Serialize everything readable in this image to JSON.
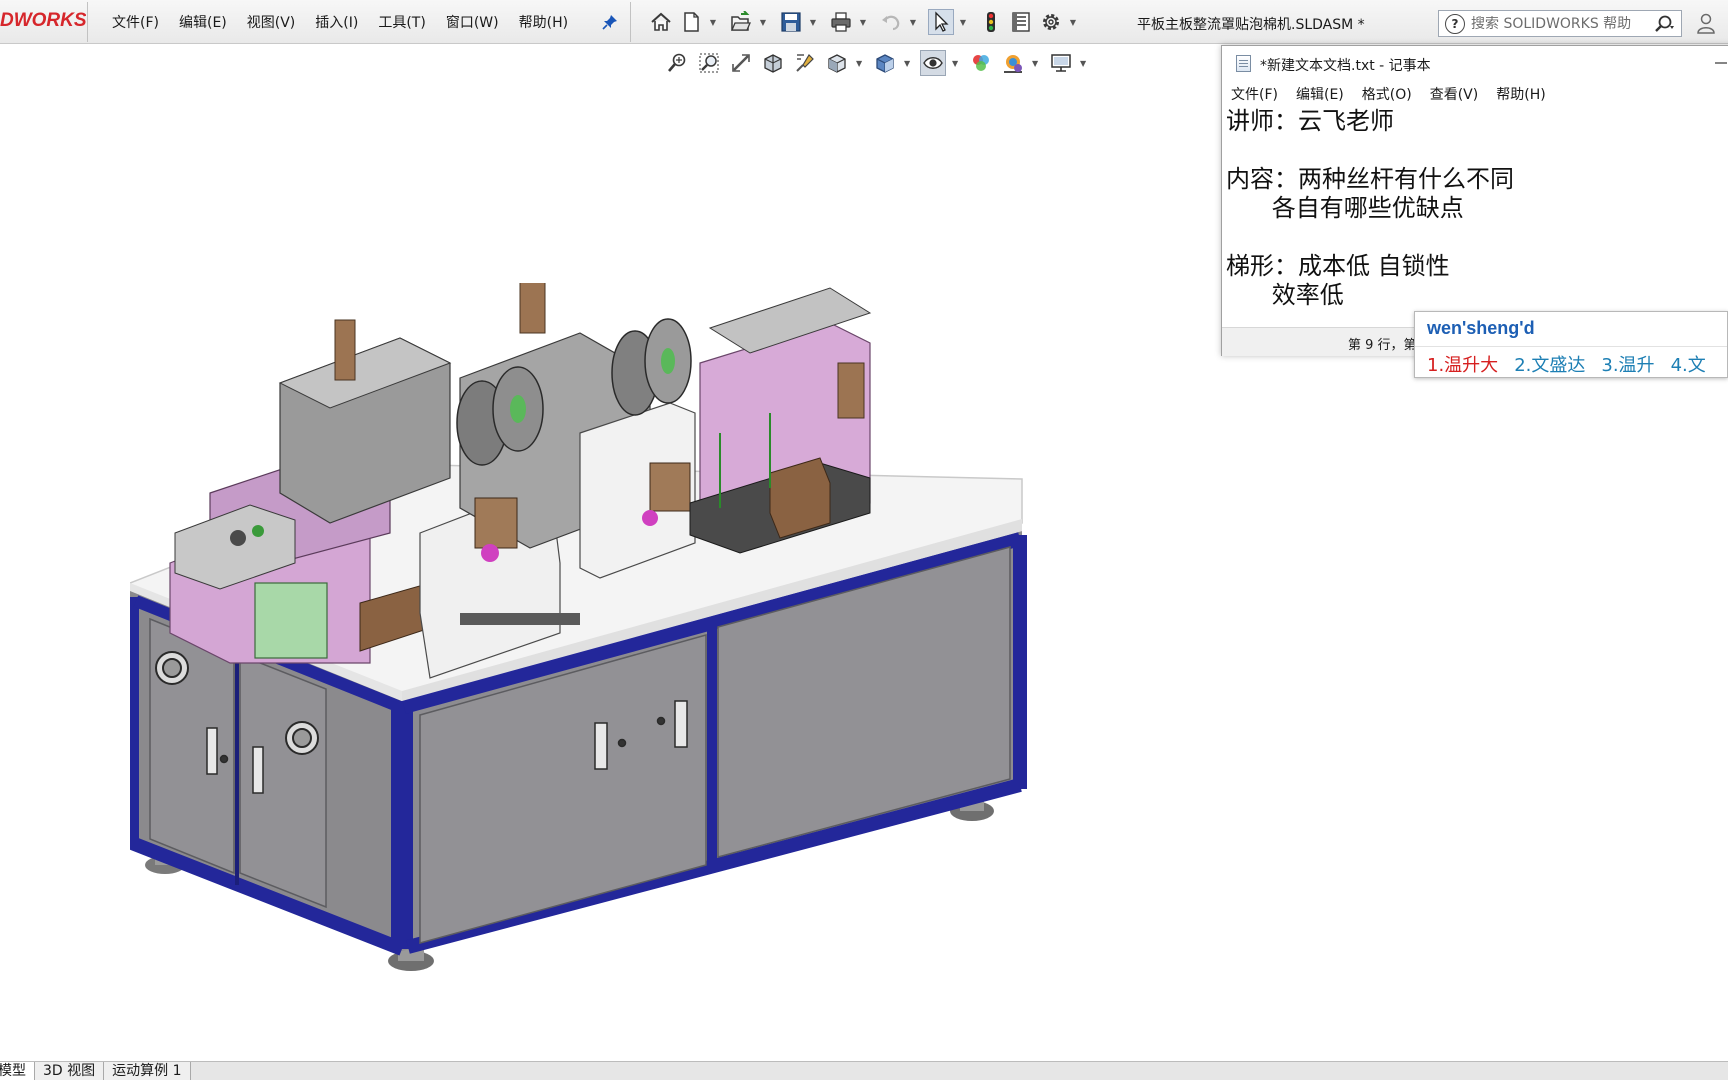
{
  "solidworks": {
    "logo_text": "DWORKS",
    "menu": [
      "文件(F)",
      "编辑(E)",
      "视图(V)",
      "插入(I)",
      "工具(T)",
      "窗口(W)",
      "帮助(H)"
    ],
    "document_title": "平板主板整流罩贴泡棉机.SLDASM *",
    "search_placeholder": "搜索 SOLIDWORKS 帮助",
    "quick_toolbar_icons": [
      "home-icon",
      "new-document-icon",
      "open-icon",
      "save-icon",
      "print-icon",
      "undo-icon",
      "select-arrow-icon",
      "traffic-light-icon",
      "file-properties-icon",
      "options-gear-icon"
    ],
    "view_toolbar_icons": [
      "zoom-to-fit-icon",
      "zoom-area-icon",
      "previous-view-icon",
      "section-view-icon",
      "dynamic-annotation-icon",
      "view-orientation-icon",
      "display-style-icon",
      "hide-show-items-icon",
      "edit-appearance-icon",
      "apply-scene-icon",
      "view-settings-icon"
    ],
    "bottom_tabs": [
      "模型",
      "3D 视图",
      "运动算例 1"
    ],
    "active_bottom_tab": 0
  },
  "notepad": {
    "title": "*新建文本文档.txt - 记事本",
    "menu": [
      "文件(F)",
      "编辑(E)",
      "格式(O)",
      "查看(V)",
      "帮助(H)"
    ],
    "lines": [
      "讲师：云飞老师",
      "",
      "内容：两种丝杆有什么不同",
      "      各自有哪些优缺点",
      "",
      "梯形：成本低 自锁性",
      "      效率低 "
    ],
    "status_position": "第 9 行，第"
  },
  "ime": {
    "composition": "wen'sheng'd",
    "candidates": [
      "1.温升大",
      "2.文盛达",
      "3.温升",
      "4.文"
    ]
  },
  "colors": {
    "frame_blue": "#23279a",
    "cabinet_gray": "#8a8a8c",
    "table_white": "#f5f5f5",
    "panel_pink": "#d8a8d8",
    "sw_red": "#d6262b"
  }
}
